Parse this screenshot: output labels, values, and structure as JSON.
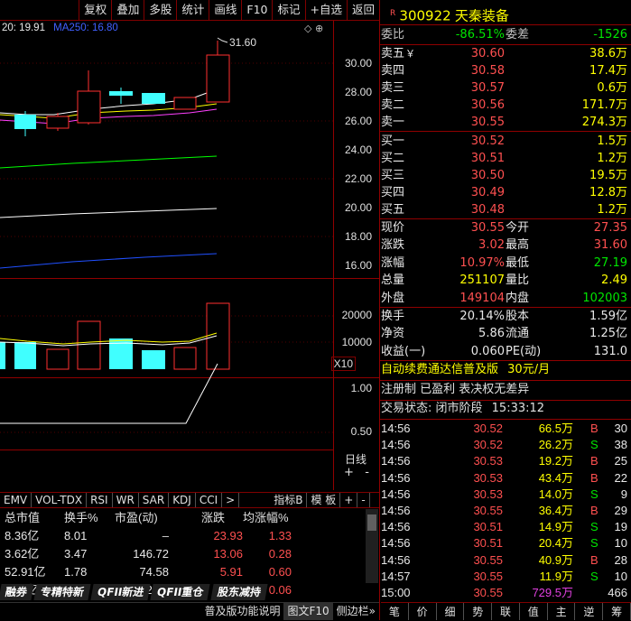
{
  "toolbar": [
    "复权",
    "叠加",
    "多股",
    "统计",
    "画线",
    "F10",
    "标记",
    "+自选",
    "返回"
  ],
  "chart": {
    "ma_header": "20: 19.91",
    "ma250": "MA250: 16.80",
    "high_label": "31.60",
    "price_ticks": [
      "30.00",
      "28.00",
      "26.00",
      "24.00",
      "22.00",
      "20.00",
      "18.00",
      "16.00"
    ],
    "vol_ticks": [
      "20000",
      "10000"
    ],
    "vol_unit": "X10",
    "ind_ticks": [
      "1.00",
      "0.50"
    ],
    "day_line": "日线",
    "colors": {
      "up": "#ff3030",
      "down": "#40ffff",
      "ma_white": "#ffffff",
      "ma_yellow": "#ffff00",
      "ma_magenta": "#ff40ff",
      "ma_green": "#00ff00",
      "ma_blue": "#2060ff"
    }
  },
  "ind_tabs": [
    "EMV",
    "VOL-TDX",
    "RSI",
    "WR",
    "SAR",
    "KDJ",
    "CCI",
    ">",
    "指标B",
    "模 板",
    "+",
    "-"
  ],
  "table": {
    "headers": [
      "总市值",
      "换手%",
      "市盈(动)",
      "涨跌",
      "均涨幅%"
    ],
    "rows": [
      [
        "8.36亿",
        "8.01",
        "–",
        "23.93",
        "1.33"
      ],
      [
        "3.62亿",
        "3.47",
        "146.72",
        "13.06",
        "0.28"
      ],
      [
        "52.91亿",
        "1.78",
        "74.58",
        "5.91",
        "0.60"
      ],
      [
        "3.21亿",
        "2.22",
        "42.36",
        "8.35",
        "0.06"
      ]
    ]
  },
  "bottom_tabs": [
    "融券",
    "专精特新",
    "QFII新进",
    "QFII重仓",
    "股东减持"
  ],
  "status_bar": [
    "普及版功能说明",
    "图文F10",
    "侧边栏»"
  ],
  "quote": {
    "r_mark": "R",
    "code": "300922",
    "name": "天秦装备",
    "weibi_label": "委比",
    "weibi": "-86.51%",
    "weicha_label": "委差",
    "weicha": "-1526",
    "asks": [
      {
        "label": "卖五",
        "extra": "￥",
        "price": "30.60",
        "vol": "38.6万"
      },
      {
        "label": "卖四",
        "price": "30.58",
        "vol": "17.4万"
      },
      {
        "label": "卖三",
        "price": "30.57",
        "vol": "0.6万"
      },
      {
        "label": "卖二",
        "price": "30.56",
        "vol": "171.7万"
      },
      {
        "label": "卖一",
        "price": "30.55",
        "vol": "274.3万"
      }
    ],
    "bids": [
      {
        "label": "买一",
        "price": "30.52",
        "vol": "1.5万"
      },
      {
        "label": "买二",
        "price": "30.51",
        "vol": "1.2万"
      },
      {
        "label": "买三",
        "price": "30.50",
        "vol": "19.5万"
      },
      {
        "label": "买四",
        "price": "30.49",
        "vol": "12.8万"
      },
      {
        "label": "买五",
        "price": "30.48",
        "vol": "1.2万"
      }
    ],
    "stats": [
      {
        "l1": "现价",
        "v1": "30.55",
        "l2": "今开",
        "v2": "27.35"
      },
      {
        "l1": "涨跌",
        "v1": "3.02",
        "l2": "最高",
        "v2": "31.60"
      },
      {
        "l1": "涨幅",
        "v1": "10.97%",
        "l2": "最低",
        "v2": "27.19"
      },
      {
        "l1": "总量",
        "v1": "251107",
        "l2": "量比",
        "v2": "2.49"
      },
      {
        "l1": "外盘",
        "v1": "149104",
        "l2": "内盘",
        "v2": "102003"
      }
    ],
    "stats2": [
      {
        "l1": "换手",
        "v1": "20.14%",
        "l2": "股本",
        "v2": "1.59亿"
      },
      {
        "l1": "净资",
        "v1": "5.86",
        "l2": "流通",
        "v2": "1.25亿"
      },
      {
        "l1": "收益(一)",
        "v1": "0.060",
        "l2": "PE(动)",
        "v2": "131.0"
      }
    ],
    "ad1": "自动续费通达信普及版",
    "ad1_price": "30元/月",
    "ad2": "注册制 已盈利 表决权无差异",
    "trade_status_label": "交易状态: 闭市阶段",
    "trade_status_time": "15:33:12",
    "ticks": [
      {
        "t": "14:56",
        "p": "30.52",
        "v": "66.5万",
        "d": "B",
        "n": "30"
      },
      {
        "t": "14:56",
        "p": "30.52",
        "v": "26.2万",
        "d": "S",
        "n": "38"
      },
      {
        "t": "14:56",
        "p": "30.53",
        "v": "19.2万",
        "d": "B",
        "n": "25"
      },
      {
        "t": "14:56",
        "p": "30.53",
        "v": "43.4万",
        "d": "B",
        "n": "22"
      },
      {
        "t": "14:56",
        "p": "30.53",
        "v": "14.0万",
        "d": "S",
        "n": "9"
      },
      {
        "t": "14:56",
        "p": "30.55",
        "v": "36.4万",
        "d": "B",
        "n": "29"
      },
      {
        "t": "14:56",
        "p": "30.51",
        "v": "14.9万",
        "d": "S",
        "n": "19"
      },
      {
        "t": "14:56",
        "p": "30.51",
        "v": "20.4万",
        "d": "S",
        "n": "10"
      },
      {
        "t": "14:56",
        "p": "30.55",
        "v": "40.9万",
        "d": "B",
        "n": "28"
      },
      {
        "t": "14:57",
        "p": "30.55",
        "v": "11.9万",
        "d": "S",
        "n": "10"
      },
      {
        "t": "15:00",
        "p": "30.55",
        "v": "729.5万",
        "d": "",
        "n": "466"
      }
    ],
    "buttons": [
      "笔",
      "价",
      "细",
      "势",
      "联",
      "值",
      "主",
      "逆",
      "筹"
    ]
  }
}
